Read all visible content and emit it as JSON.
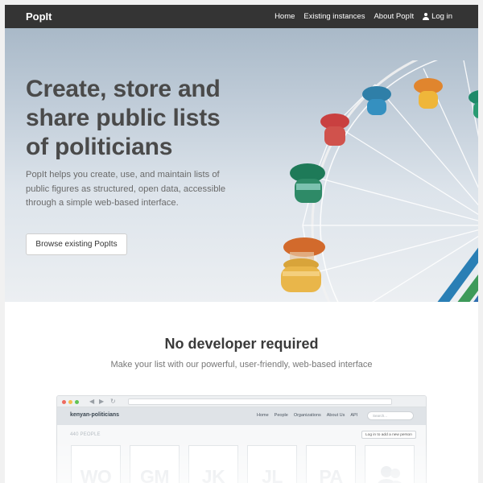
{
  "navbar": {
    "brand": "PopIt",
    "links": [
      "Home",
      "Existing instances",
      "About PopIt",
      "Log in"
    ],
    "login_icon": "user-icon"
  },
  "hero": {
    "title": "Create, store and share public lists of politicians",
    "lead": "PopIt helps you create, use, and maintain lists of public figures as structured, open data, accessible through a simple web-based interface.",
    "button_label": "Browse existing PopIts",
    "image": "ferris-wheel-photo"
  },
  "section": {
    "heading": "No developer required",
    "subtitle": "Make your list with our powerful, user-friendly, web-based interface"
  },
  "mockup": {
    "window_dots": [
      "#ee6a5f",
      "#f5bd4f",
      "#61c454"
    ],
    "site_title": "kenyan-politicians",
    "nav_links": [
      "Home",
      "People",
      "Organizations",
      "About Us",
      "API"
    ],
    "search_placeholder": "Search...",
    "people_count": "440 PEOPLE",
    "add_button": "Log in to add a new person",
    "cards": [
      "WO",
      "GM",
      "JK",
      "JL",
      "PA"
    ],
    "last_card_icon": "person-silhouette-icon"
  },
  "colors": {
    "navbar": "#343434",
    "heading_text": "#4a4a4a",
    "body_text": "#6a6a6a"
  }
}
